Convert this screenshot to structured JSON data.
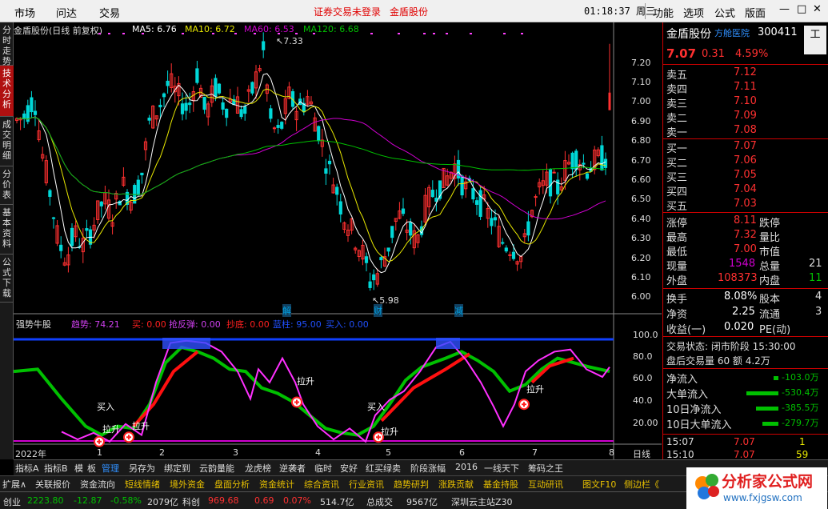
{
  "menu": {
    "items": [
      "市场",
      "问达",
      "交易"
    ],
    "warning": "证券交易未登录",
    "stock_link": "金盾股份",
    "clock": "01:18:37 周三",
    "right": [
      "功能",
      "选项",
      "公式",
      "版面"
    ]
  },
  "side_tabs": [
    "分时走势",
    "技术分析",
    "成交明细",
    "分价表",
    "基本资料",
    "公式下载"
  ],
  "main_title": {
    "name": "金盾股份(日线 前复权)",
    "ma5": "MA5: 6.76",
    "ma10": "MA10: 6.72",
    "ma60": "MA60: 6.53",
    "ma120": "MA120: 6.68"
  },
  "price_axis": [
    "7.20",
    "7.10",
    "7.00",
    "6.90",
    "6.80",
    "6.70",
    "6.60",
    "6.50",
    "6.40",
    "6.30",
    "6.20",
    "6.10",
    "6.00"
  ],
  "annotations": {
    "high": "7.33",
    "low": "5.98",
    "marks": [
      "解",
      "财",
      "减"
    ]
  },
  "indicator": {
    "name": "强势牛股",
    "trend": "趋势: 74.21",
    "buy": "买: 0.00",
    "rebound": "抢反弹: 0.00",
    "bottom": "抄底: 0.00",
    "blue": "蓝柱: 95.00",
    "buy_in": "买入: 0.00",
    "axis": [
      "100.0",
      "80.0",
      "60.0",
      "40.0",
      "20.00"
    ],
    "labels": [
      "买入",
      "拉升",
      "拉升",
      "拉升",
      "买入",
      "拉升",
      "拉升"
    ]
  },
  "x_axis": {
    "year": "2022年",
    "months": [
      "1",
      "2",
      "3",
      "4",
      "5",
      "6",
      "7",
      "8"
    ],
    "period": "日线"
  },
  "quote": {
    "name": "金盾股份",
    "tag": "方舱医院",
    "code": "300411",
    "price": "7.07",
    "change": "0.31",
    "pct": "4.59%",
    "asks": [
      {
        "l": "卖五",
        "p": "7.12"
      },
      {
        "l": "卖四",
        "p": "7.11"
      },
      {
        "l": "卖三",
        "p": "7.10"
      },
      {
        "l": "卖二",
        "p": "7.09"
      },
      {
        "l": "卖一",
        "p": "7.08"
      }
    ],
    "bids": [
      {
        "l": "买一",
        "p": "7.07"
      },
      {
        "l": "买二",
        "p": "7.06"
      },
      {
        "l": "买三",
        "p": "7.05"
      },
      {
        "l": "买四",
        "p": "7.04"
      },
      {
        "l": "买五",
        "p": "7.03"
      }
    ],
    "stats": [
      {
        "l": "涨停",
        "v": "8.11",
        "l2": "跌停"
      },
      {
        "l": "最高",
        "v": "7.32",
        "l2": "量比"
      },
      {
        "l": "最低",
        "v": "7.00",
        "l2": "市值"
      },
      {
        "l": "现量",
        "v": "1548",
        "l2": "总量",
        "v2": "21"
      },
      {
        "l": "外盘",
        "v": "108373",
        "l2": "内盘",
        "v2": "11"
      }
    ],
    "turnover": {
      "l": "换手",
      "v": "8.08%",
      "l2": "股本",
      "v2": "4"
    },
    "netasset": {
      "l": "净资",
      "v": "2.25",
      "l2": "流通",
      "v2": "3"
    },
    "eps": {
      "l": "收益(一)",
      "v": "0.020",
      "l2": "PE(动)"
    },
    "trade_state": "交易状态: 闭市阶段 15:30:00",
    "after": "盘后交易量 60 额 4.2万",
    "flows": [
      {
        "l": "净流入",
        "v": "-103.0万"
      },
      {
        "l": "大单流入",
        "v": "-530.4万"
      },
      {
        "l": "10日净流入",
        "v": "-385.5万"
      },
      {
        "l": "10日大单流入",
        "v": "-279.7万"
      }
    ],
    "ticks": [
      {
        "t": "15:07",
        "p": "7.07",
        "v": "1"
      },
      {
        "t": "15:10",
        "p": "7.07",
        "v": "59"
      }
    ],
    "side_btn": "工"
  },
  "bottom_tabs": [
    "指标A",
    "指标B",
    "模",
    "板",
    "管理",
    "另存为",
    "绑定到",
    "云韵量能",
    "龙虎榜",
    "逆袭者",
    "临时",
    "安好",
    "红买绿卖",
    "阶段涨幅",
    "2016",
    "一线天下",
    "筹码之王"
  ],
  "bottom_tabs2": [
    "扩展∧",
    "关联报价",
    "资金流向",
    "短线情绪",
    "境外资金",
    "盘面分析",
    "资金统计",
    "综合资讯",
    "行业资讯",
    "趋势研判",
    "涨跌贡献",
    "基金持股",
    "互动研讯",
    "图文F10",
    "侧边栏《"
  ],
  "status": {
    "board": "创业",
    "v1": "2223.80",
    "v2": "-12.87",
    "v3": "-0.58%",
    "v4": "2079亿",
    "k": "科创",
    "v5": "969.68",
    "v6": "0.69",
    "v7": "0.07%",
    "v8": "514.7亿",
    "total": "总成交",
    "v9": "9567亿",
    "station": "深圳云主站Z30"
  },
  "logo": {
    "text": "分析家公式网",
    "url": "www.fxjgsw.com"
  },
  "colors": {
    "up": "#ff3030",
    "down": "#00d8d8",
    "ma5": "#ffffff",
    "ma10": "#e8e800",
    "ma60": "#d000d0",
    "ma120": "#00c000"
  }
}
